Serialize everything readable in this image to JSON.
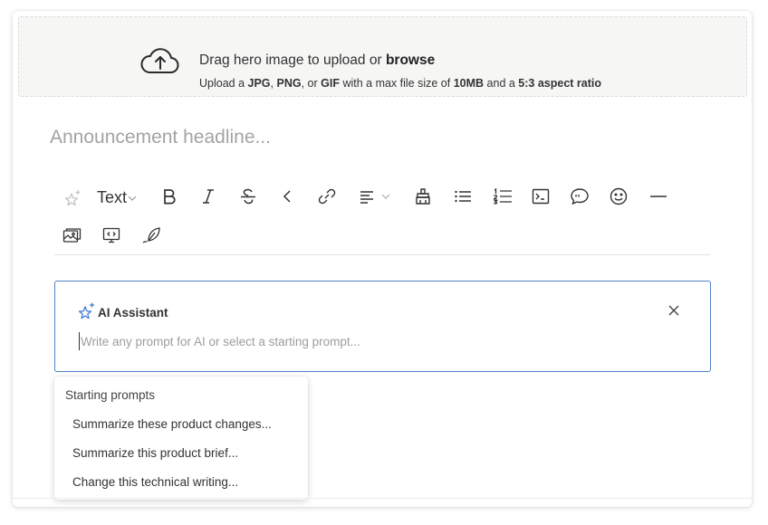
{
  "upload": {
    "title_prefix": "Drag hero image to upload or ",
    "browse_label": "browse",
    "sub_1": "Upload a ",
    "jpg": "JPG",
    "sub_2": ", ",
    "png": "PNG",
    "sub_3": ", or ",
    "gif": "GIF",
    "sub_4": " with a max file size of ",
    "size": "10MB",
    "sub_5": " and a ",
    "ratio": "5:3 aspect ratio",
    "icon": "cloud-upload-icon"
  },
  "editor": {
    "headline_placeholder": "Announcement headline..."
  },
  "toolbar": {
    "text_style_label": "Text",
    "icons": [
      "ai-sparkle-icon",
      "chevron-down-icon",
      "bold-icon",
      "italic-icon",
      "strikethrough-icon",
      "code-inline-icon",
      "link-icon",
      "align-left-icon",
      "highlight-icon",
      "bullet-list-icon",
      "numbered-list-icon",
      "code-block-icon",
      "quote-comment-icon",
      "emoji-icon",
      "horizontal-rule-icon",
      "gallery-icon",
      "embed-icon",
      "drawing-icon"
    ]
  },
  "ai_assistant": {
    "title": "AI Assistant",
    "placeholder": "Write any prompt for AI or select a starting prompt...",
    "close_icon": "close-icon",
    "accent": "#4f83c7"
  },
  "starting_prompts": {
    "title": "Starting prompts",
    "items": [
      "Summarize these product changes...",
      "Summarize this product brief...",
      "Change this technical writing..."
    ]
  }
}
